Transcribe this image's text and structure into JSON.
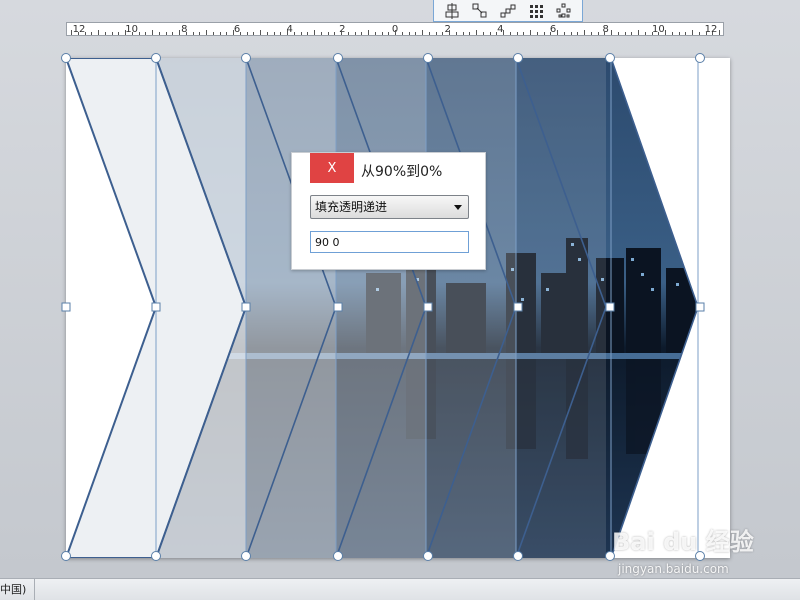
{
  "toolbar": {
    "icons": [
      "align-center-icon",
      "distribute-diagonal-icon",
      "stair-step-icon",
      "grid-dots-icon",
      "scatter-dots-icon"
    ]
  },
  "ruler": {
    "labels": [
      "12",
      "10",
      "8",
      "6",
      "4",
      "2",
      "0",
      "2",
      "4",
      "6",
      "8",
      "10",
      "12"
    ]
  },
  "dialog": {
    "close_label": "X",
    "title": "从90%到0%",
    "select_value": "填充透明递进",
    "input_value": "90 0"
  },
  "statusbar": {
    "language": "中国)"
  },
  "watermark": {
    "main": "Bai du 经验",
    "sub": "jingyan.baidu.com"
  },
  "colors": {
    "shape_stroke": "#3d5f8f",
    "dialog_close": "#e04343",
    "accent_blue": "#6fa0d6"
  }
}
